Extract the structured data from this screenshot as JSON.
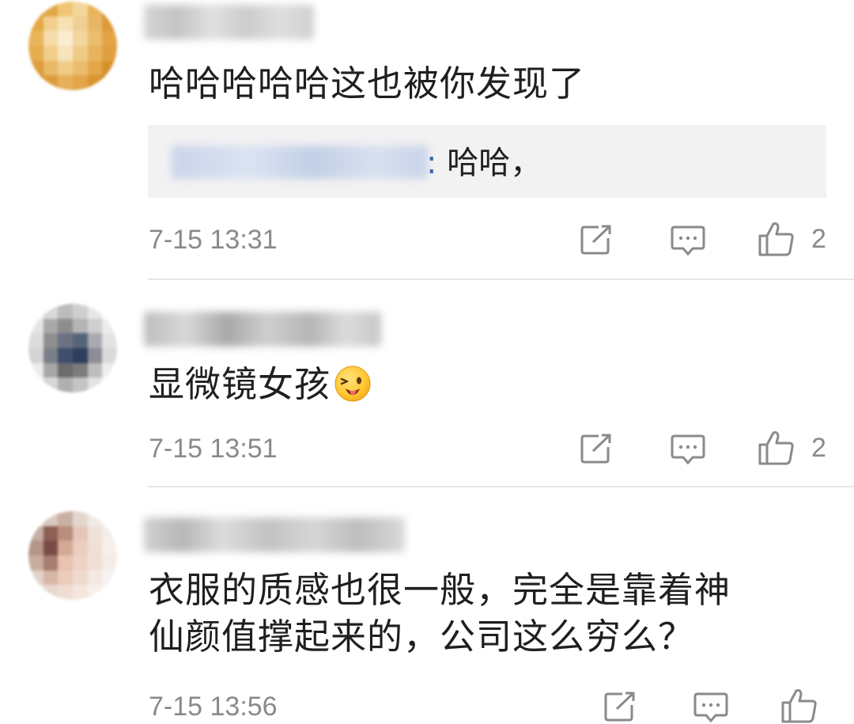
{
  "comments": [
    {
      "text": "哈哈哈哈哈这也被你发现了",
      "reply": {
        "separator": ":",
        "text": " 哈哈，"
      },
      "timestamp": "7-15 13:31",
      "like_count": "2"
    },
    {
      "text": "显微镜女孩",
      "emoji": "winking-tongue-emoji",
      "timestamp": "7-15 13:51",
      "like_count": "2"
    },
    {
      "text_line1": "衣服的质感也很一般，完全是靠着神",
      "text_line2": "仙颜值撑起来的，公司这么穷么？",
      "timestamp": "7-15 13:56",
      "like_count": ""
    }
  ],
  "colors": {
    "text": "#1f1f1f",
    "meta": "#8a8a8a",
    "icon": "#8a8a8a",
    "quote_bg": "#f2f2f2",
    "divider": "#e6e6e6",
    "link": "#3e6bb0"
  },
  "icons": [
    "share-icon",
    "comment-icon",
    "like-icon"
  ]
}
